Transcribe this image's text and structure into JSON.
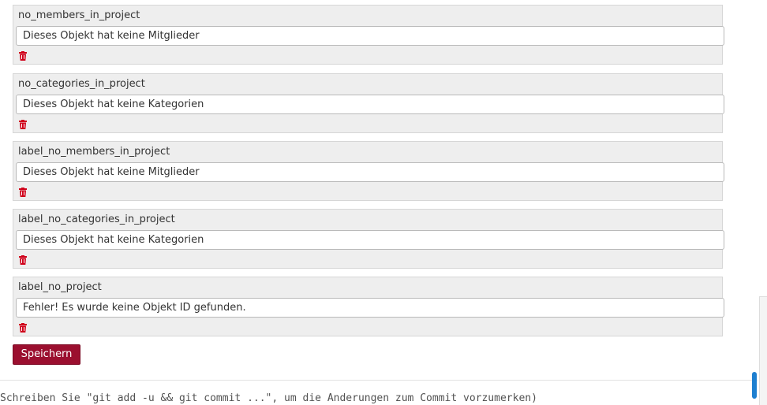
{
  "entries": [
    {
      "key": "no_members_in_project",
      "value": "Dieses Objekt hat keine Mitglieder"
    },
    {
      "key": "no_categories_in_project",
      "value": "Dieses Objekt hat keine Kategorien"
    },
    {
      "key": "label_no_members_in_project",
      "value": "Dieses Objekt hat keine Mitglieder"
    },
    {
      "key": "label_no_categories_in_project",
      "value": "Dieses Objekt hat keine Kategorien"
    },
    {
      "key": "label_no_project",
      "value": "Fehler! Es wurde keine Objekt ID gefunden."
    }
  ],
  "actions": {
    "save_label": "Speichern"
  },
  "icons": {
    "delete": "trash-icon",
    "delete_color": "#d0021b"
  },
  "colors": {
    "button_bg": "#9b0f2f",
    "entry_bg": "#eeeeee",
    "scrollbar": "#1d7fd0"
  },
  "background": {
    "partial_text": "Schreiben Sie \"git add -u && git commit ...\", um die Änderungen zum Commit vorzumerken)"
  }
}
